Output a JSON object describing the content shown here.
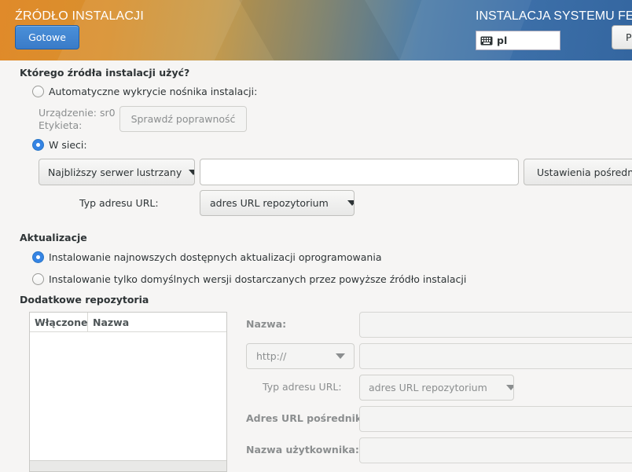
{
  "header": {
    "title": "ŹRÓDŁO INSTALACJI",
    "done_label": "Gotowe",
    "system_title": "INSTALACJA SYSTEMU FED",
    "keyboard_layout": "pl",
    "help_label": "P"
  },
  "source": {
    "heading": "Którego źródła instalacji użyć?",
    "auto_label": "Automatyczne wykrycie nośnika instalacji:",
    "device_label": "Urządzenie: sr0",
    "volume_label": "Etykieta:",
    "verify_label": "Sprawdź poprawność",
    "network_label": "W sieci:",
    "mirror_select": "Najbliższy serwer lustrzany",
    "url_value": "",
    "proxy_label": "Ustawienia pośredn",
    "url_type_label": "Typ adresu URL:",
    "url_type_value": "adres URL repozytorium",
    "selected": "network"
  },
  "updates": {
    "heading": "Aktualizacje",
    "option_latest": "Instalowanie najnowszych dostępnych aktualizacji oprogramowania",
    "option_default": "Instalowanie tylko domyślnych wersji dostarczanych przez powyższe źródło instalacji",
    "selected": "latest"
  },
  "repos": {
    "heading": "Dodatkowe repozytoria",
    "columns": [
      "Włączone",
      "Nazwa"
    ],
    "name_label": "Nazwa:",
    "protocol_value": "http://",
    "url_type_label": "Typ adresu URL:",
    "url_type_value": "adres URL repozytorium",
    "proxy_url_label": "Adres URL pośrednika:",
    "username_label": "Nazwa użytkownika:"
  },
  "colors": {
    "accent": "#3584e4",
    "header_orange": "#e08a2a",
    "header_blue": "#3466a0"
  }
}
